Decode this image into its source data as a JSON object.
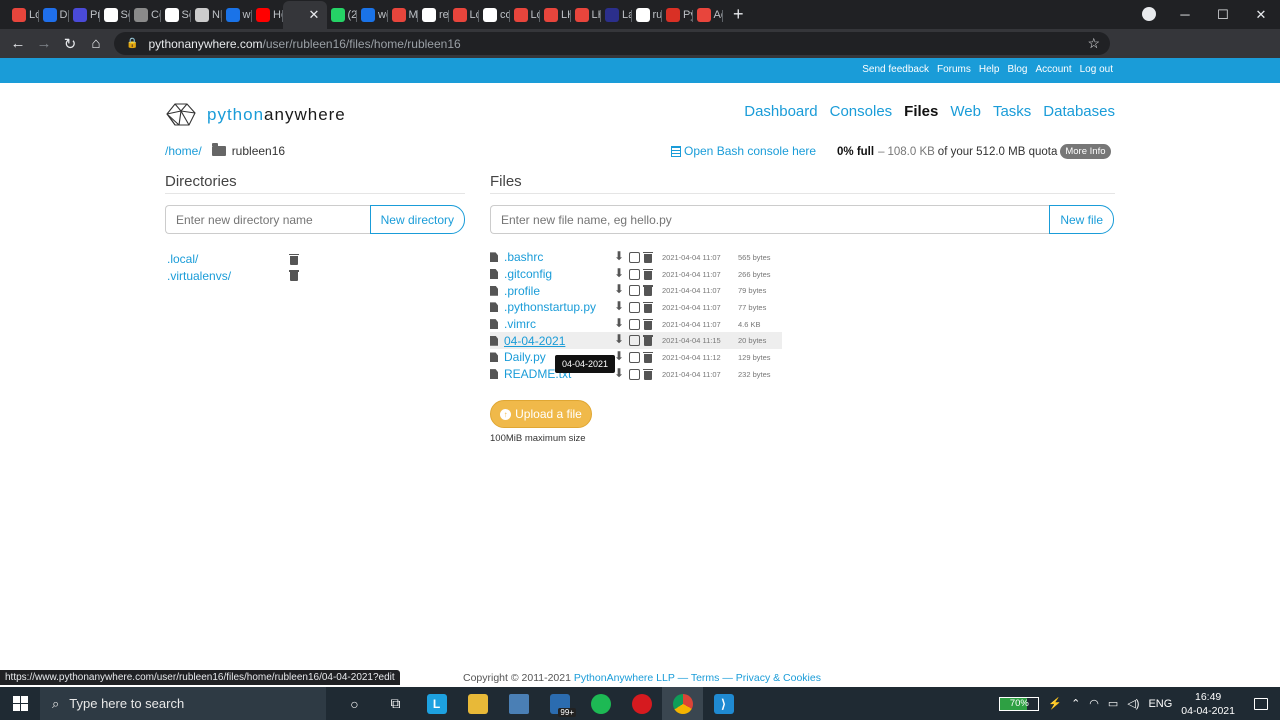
{
  "browser": {
    "tabs": [
      {
        "label": "Lo",
        "color": "#e8453c"
      },
      {
        "label": "De",
        "color": "#1f6feb"
      },
      {
        "label": "Pri",
        "color": "#4a4ad8"
      },
      {
        "label": "Se",
        "color": "#ffffff"
      },
      {
        "label": "Ce",
        "color": "#8a8a8a"
      },
      {
        "label": "Se",
        "color": "#ffffff"
      },
      {
        "label": "NL",
        "color": "#cccccc"
      },
      {
        "label": "we",
        "color": "#1a73e8"
      },
      {
        "label": "Ho",
        "color": "#ff0000"
      },
      {
        "label": "",
        "color": "#35363a"
      },
      {
        "label": "(24",
        "color": "#25d366"
      },
      {
        "label": "we",
        "color": "#1a73e8"
      },
      {
        "label": "Ma",
        "color": "#e8453c"
      },
      {
        "label": "rec",
        "color": "#ffffff"
      },
      {
        "label": "Lo",
        "color": "#e8453c"
      },
      {
        "label": "co",
        "color": "#ffffff"
      },
      {
        "label": "Lo",
        "color": "#e8453c"
      },
      {
        "label": "LH",
        "color": "#e8453c"
      },
      {
        "label": "LH",
        "color": "#e8453c"
      },
      {
        "label": "La",
        "color": "#2b2f8c"
      },
      {
        "label": "rut",
        "color": "#ffffff"
      },
      {
        "label": "Py",
        "color": "#d93025"
      },
      {
        "label": "Ac",
        "color": "#e8453c"
      }
    ],
    "active_tab_index": 9,
    "url_host": "pythonanywhere.com",
    "url_path": "/user/rubleen16/files/home/rubleen16",
    "status_url": "https://www.pythonanywhere.com/user/rubleen16/files/home/rubleen16/04-04-2021?edit"
  },
  "topbar": {
    "links": [
      "Send feedback",
      "Forums",
      "Help",
      "Blog",
      "Account",
      "Log out"
    ]
  },
  "logo": {
    "part1": "python",
    "part2": "anywhere"
  },
  "nav": {
    "items": [
      {
        "label": "Dashboard",
        "active": false
      },
      {
        "label": "Consoles",
        "active": false
      },
      {
        "label": "Files",
        "active": true
      },
      {
        "label": "Web",
        "active": false
      },
      {
        "label": "Tasks",
        "active": false
      },
      {
        "label": "Databases",
        "active": false
      }
    ]
  },
  "breadcrumb": {
    "home": "/home/",
    "current": "rubleen16"
  },
  "bash_link": "Open Bash console here",
  "quota": {
    "full": "0% full",
    "dash": "–",
    "used": "108.0 KB",
    "rest": "of your 512.0 MB quota",
    "more": "More Info"
  },
  "directories": {
    "title": "Directories",
    "placeholder": "Enter new directory name",
    "button": "New directory",
    "items": [
      ".local/",
      ".virtualenvs/"
    ]
  },
  "files": {
    "title": "Files",
    "placeholder": "Enter new file name, eg hello.py",
    "button": "New file",
    "items": [
      {
        "name": ".bashrc",
        "date": "2021-04-04 11:07",
        "size": "565 bytes"
      },
      {
        "name": ".gitconfig",
        "date": "2021-04-04 11:07",
        "size": "266 bytes"
      },
      {
        "name": ".profile",
        "date": "2021-04-04 11:07",
        "size": "79 bytes"
      },
      {
        "name": ".pythonstartup.py",
        "date": "2021-04-04 11:07",
        "size": "77 bytes"
      },
      {
        "name": ".vimrc",
        "date": "2021-04-04 11:07",
        "size": "4.6 KB"
      },
      {
        "name": "04-04-2021",
        "date": "2021-04-04 11:15",
        "size": "20 bytes"
      },
      {
        "name": "Daily.py",
        "date": "2021-04-04 11:12",
        "size": "129 bytes"
      },
      {
        "name": "README.txt",
        "date": "2021-04-04 11:07",
        "size": "232 bytes"
      }
    ],
    "highlighted_index": 5,
    "tooltip": "04-04-2021"
  },
  "upload": {
    "label": "Upload a file",
    "note": "100MiB maximum size"
  },
  "footer": {
    "copy": "Copyright © 2011-2021",
    "company": "PythonAnywhere LLP",
    "sep1": "—",
    "terms": "Terms",
    "sep2": "—",
    "privacy": "Privacy & Cookies"
  },
  "taskbar": {
    "search_placeholder": "Type here to search",
    "mail_badge": "99+",
    "battery": "70%",
    "lang": "ENG",
    "time": "16:49",
    "date": "04-04-2021"
  }
}
